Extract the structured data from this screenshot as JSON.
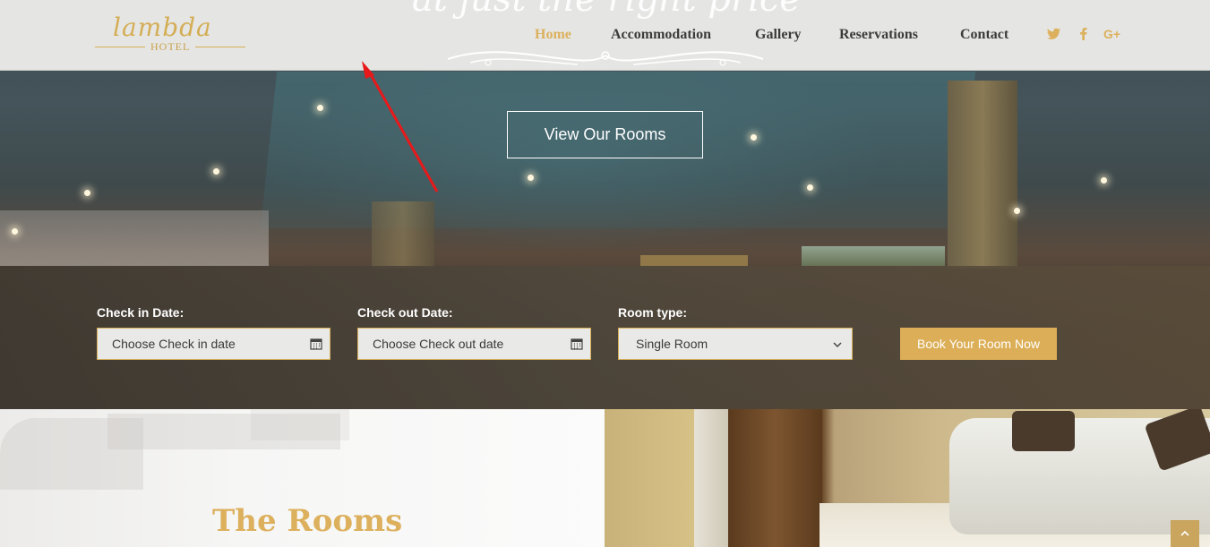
{
  "header": {
    "logo_script": "lambda",
    "logo_sub": "HOTEL",
    "tagline": "at just the right price",
    "nav": [
      {
        "label": "Home",
        "active": true
      },
      {
        "label": "Accommodation",
        "active": false
      },
      {
        "label": "Gallery",
        "active": false
      },
      {
        "label": "Reservations",
        "active": false
      },
      {
        "label": "Contact",
        "active": false
      }
    ],
    "social_icons": [
      "twitter-icon",
      "facebook-icon",
      "google-plus-icon"
    ]
  },
  "hero": {
    "cta_label": "View Our Rooms"
  },
  "booking": {
    "checkin_label": "Check in Date:",
    "checkin_placeholder": "Choose Check in date",
    "checkout_label": "Check out Date:",
    "checkout_placeholder": "Choose Check out date",
    "roomtype_label": "Room type:",
    "roomtype_value": "Single Room",
    "book_button": "Book Your Room Now"
  },
  "rooms": {
    "title": "The Rooms"
  },
  "colors": {
    "accent_gold": "#dcb05c",
    "nav_text": "#3b3b3b",
    "header_bg": "#ecece9",
    "annotation_arrow": "#e8191a"
  }
}
